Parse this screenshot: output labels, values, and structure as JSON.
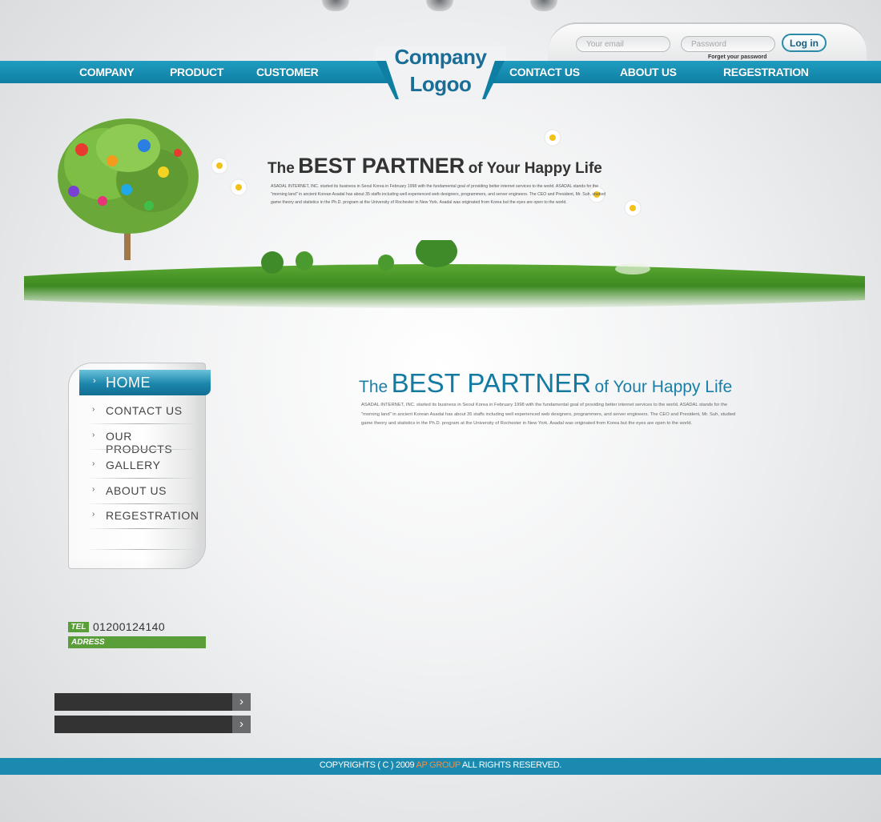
{
  "login": {
    "email_placeholder": "Your email",
    "password_placeholder": "Password",
    "button_label": "Log in",
    "forget_label": "Forget your password"
  },
  "nav": {
    "company": "COMPANY",
    "product": "PRODUCT",
    "customer": "CUSTOMER",
    "contact_us": "CONTACT US",
    "about_us": "ABOUT US",
    "registration": "REGESTRATION"
  },
  "logo": {
    "line1": "Company",
    "line2": "Logoo"
  },
  "hero": {
    "title_the": "The",
    "title_main": "BEST PARTNER",
    "title_tail": "of Your Happy Life",
    "body": "ASADAL INTERNET, INC. started its business in Seoul Korea in February 1998 with the fundamental goal of providing better internet services to the world. ASADAL stands for the \"morning land\" in ancient Korean Asadal has about 35 staffs including well experienced web designers, programmers, and server engineers. The CEO and President, Mr. Suh, studied game theory and statistics in the Ph.D. program at the University of Rochester in New York. Asadal was originated from Korea but the eyes are open to the world."
  },
  "side_menu": {
    "home": "HOME",
    "contact_us": "CONTACT US",
    "our_products": "OUR PRODUCTS",
    "gallery": "GALLERY",
    "about_us": "ABOUT US",
    "registration": "REGESTRATION"
  },
  "content": {
    "title_the": "The",
    "title_main": "BEST PARTNER",
    "title_tail": "of Your Happy Life",
    "body": "ASADAL INTERNET, INC. started its business in Seoul Korea in February 1998 with the fundamental goal of providing better internet services to the world. ASADAL stands for the \"morning land\" in ancient Korean Asadal has about 35 staffs including well experienced web designers, programmers, and server engineers. The CEO and President, Mr. Suh, studied game theory and statistics in the Ph.D. program at the University of Rochester in New York. Asadal was originated from Korea but the eyes are open to the world."
  },
  "contact": {
    "tel_label": "TEL",
    "tel_number": "01200124140",
    "adress_label": "ADRESS"
  },
  "footer": {
    "prefix": "COPYRIGHTS ( C ) 2009",
    "brand": "AP GROUP",
    "suffix": "ALL RIGHTS RESERVED."
  },
  "colors": {
    "nav_blue": "#1591b6",
    "accent_green": "#5a9e3a",
    "footer_blue": "#1a8ab0",
    "brand_orange": "#ff8a3a"
  },
  "icons": {
    "menu_chevron": "chevron-right-icon",
    "bar_arrow": "arrow-right-icon"
  }
}
